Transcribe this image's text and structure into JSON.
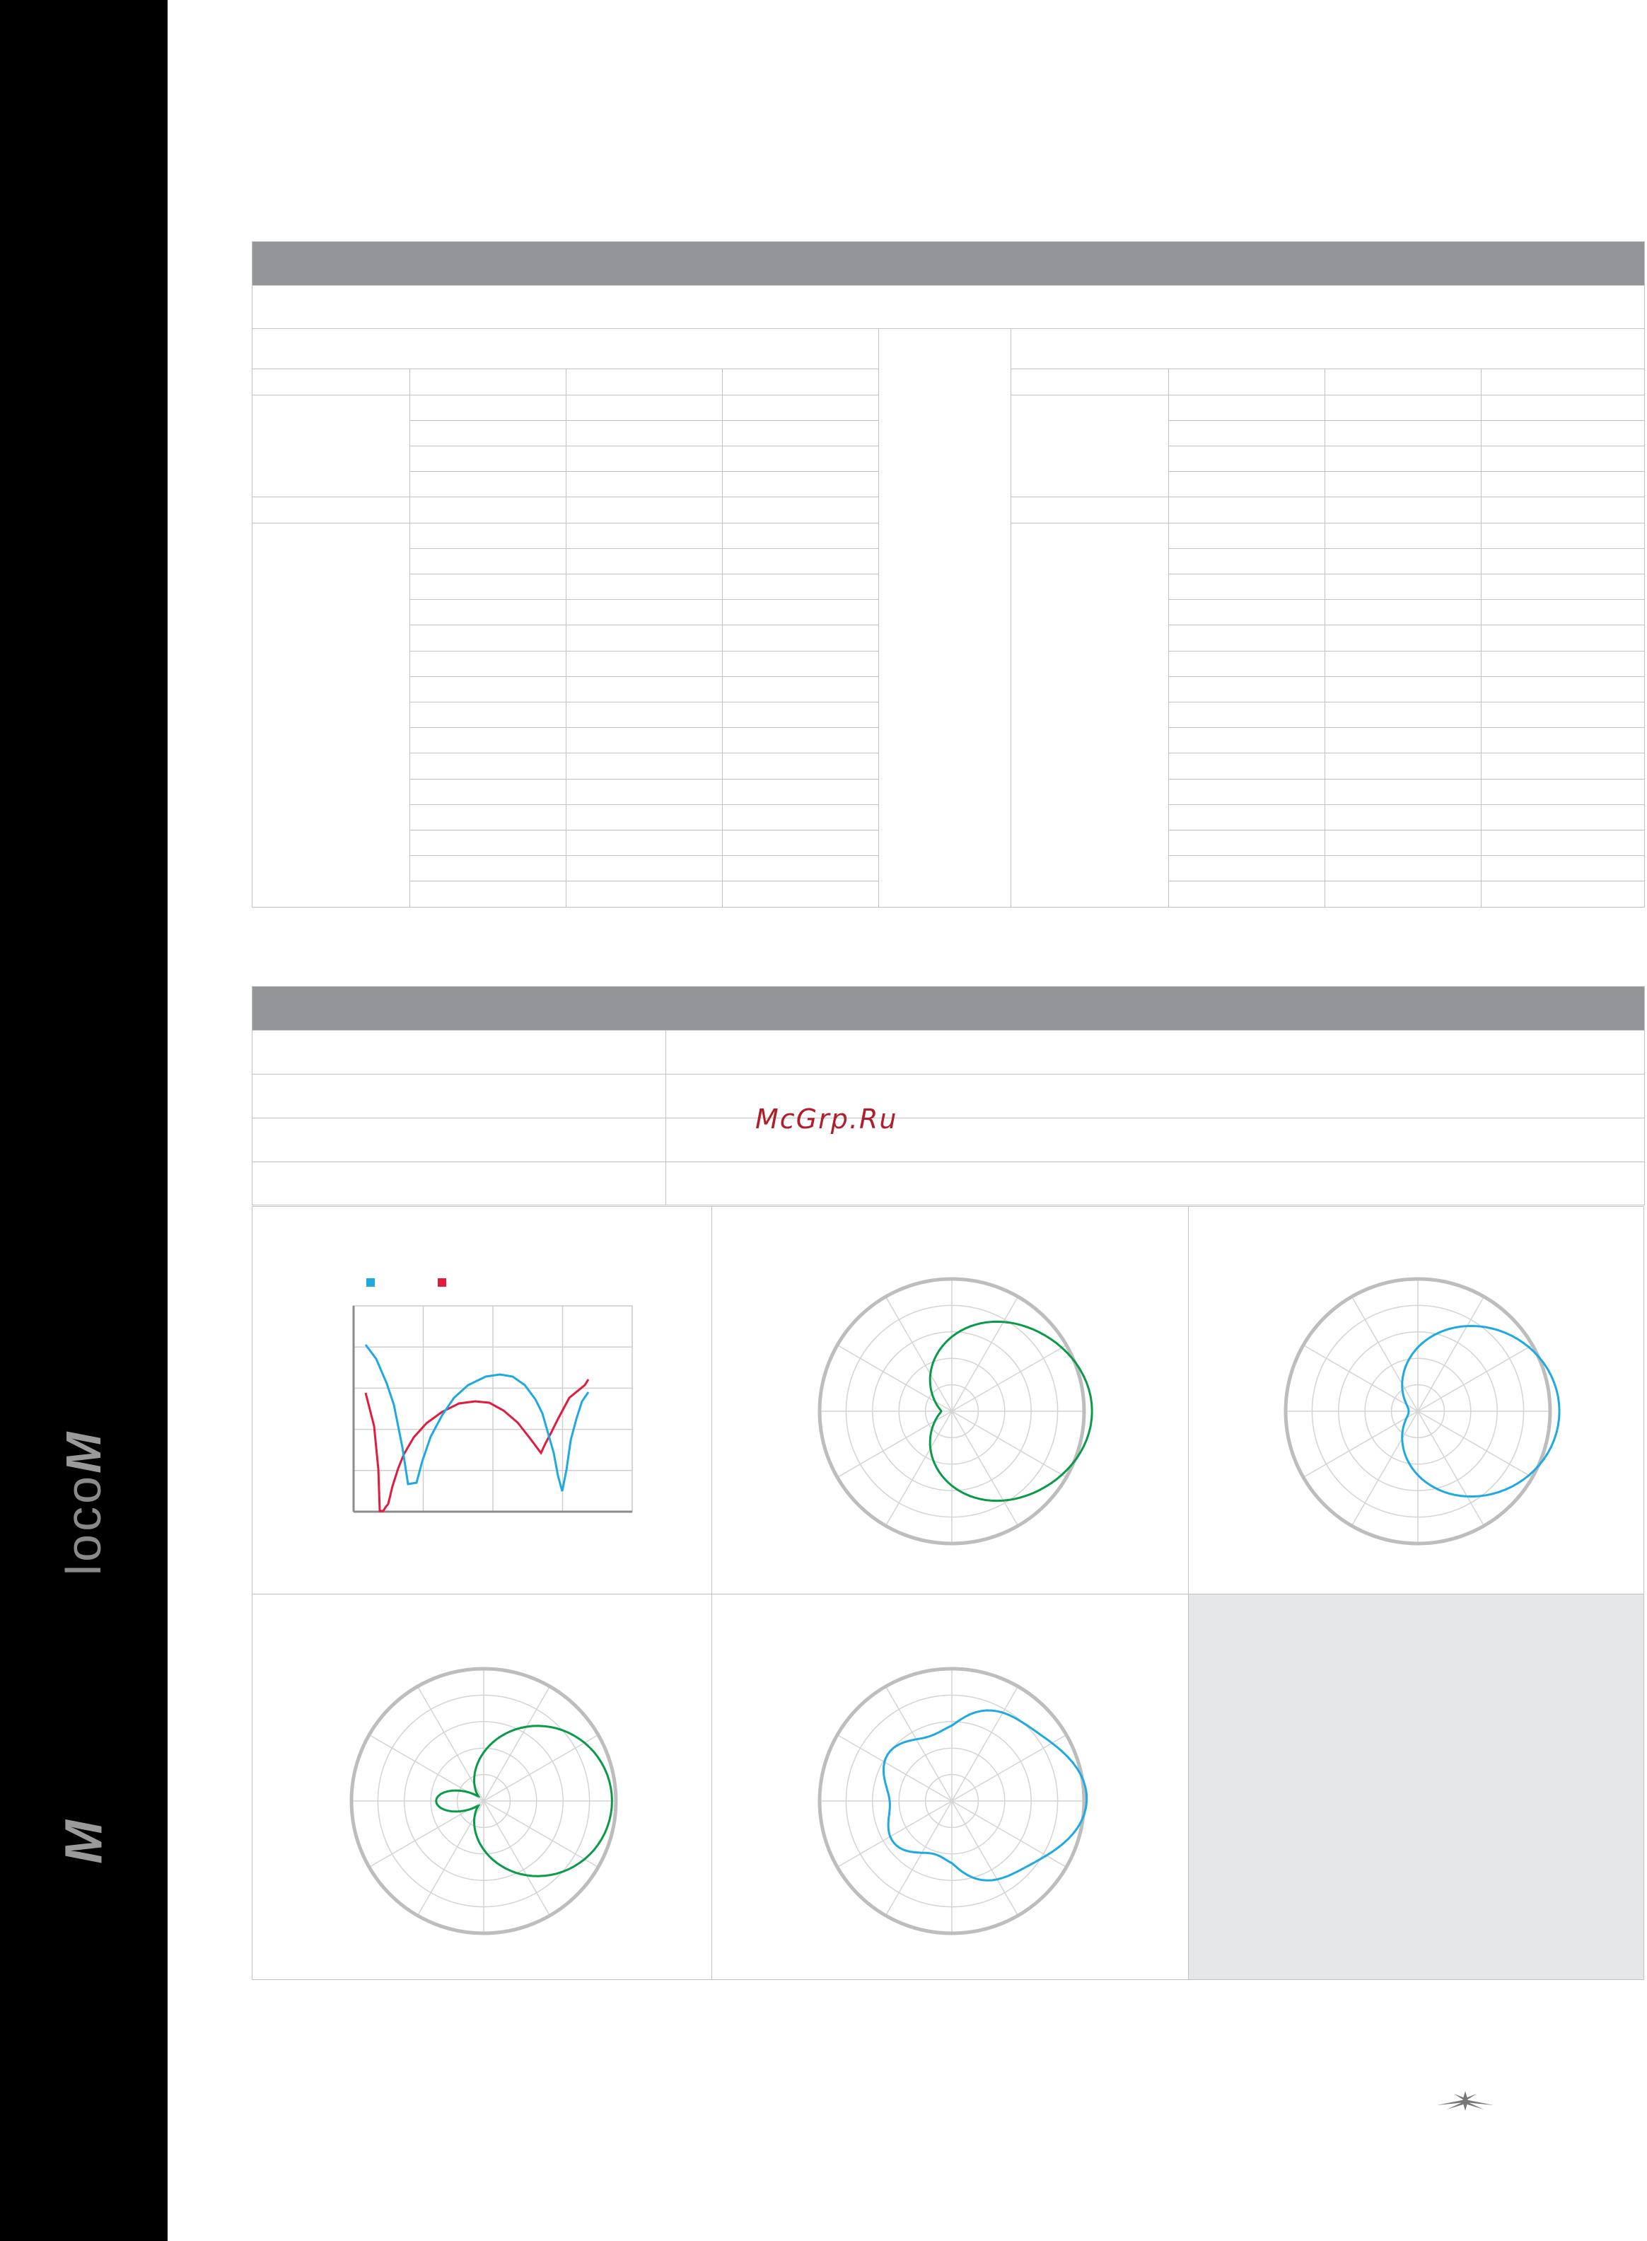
{
  "sidebar": {
    "product_prefix": "loco",
    "product_mark": "M",
    "series_mark": "M"
  },
  "watermark": "McGrp.Ru",
  "colors": {
    "sidebar": "#000000",
    "header_bar": "#939598",
    "grid": "#c2c2c2",
    "cyan": "#1fa9e1",
    "red": "#e01b3e",
    "green": "#0a9a48",
    "empty_panel": "#e6e7e8"
  },
  "charts": {
    "swr": {
      "legend": [
        {
          "color": "#1fa9e1"
        },
        {
          "color": "#e01b3e"
        }
      ]
    },
    "patterns": [
      {
        "color": "#0a9a48"
      },
      {
        "color": "#1fa9e1"
      },
      {
        "color": "#0a9a48"
      },
      {
        "color": "#1fa9e1"
      }
    ]
  },
  "footer": {
    "logo_icon": "ubiquiti-logo-icon"
  }
}
